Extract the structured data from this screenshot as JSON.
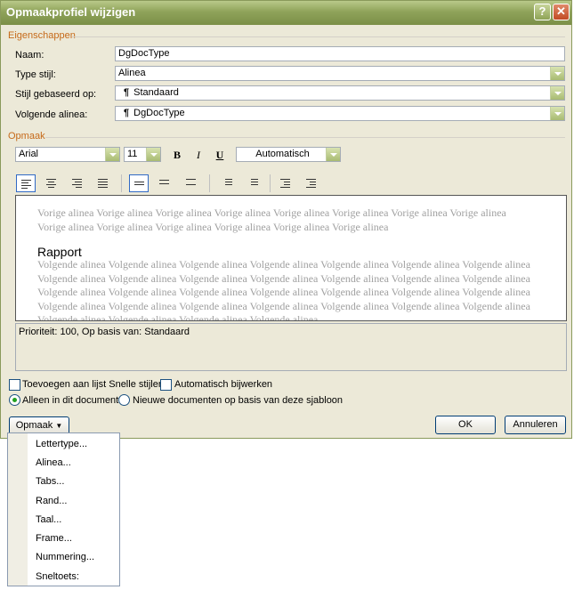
{
  "window": {
    "title": "Opmaakprofiel wijzigen",
    "help_glyph": "?",
    "close_glyph": "✕"
  },
  "sections": {
    "properties": "Eigenschappen",
    "format": "Opmaak"
  },
  "properties": {
    "name_label": "Naam:",
    "name_value": "DgDocType",
    "type_label": "Type stijl:",
    "type_value": "Alinea",
    "based_label": "Stijl gebaseerd op:",
    "based_value": "Standaard",
    "next_label": "Volgende alinea:",
    "next_value": "DgDocType",
    "pilcrow": "¶"
  },
  "format_toolbar": {
    "font": "Arial",
    "size": "11",
    "bold": "B",
    "italic": "I",
    "underline": "U",
    "color": "Automatisch"
  },
  "preview": {
    "previous": "Vorige alinea Vorige alinea Vorige alinea Vorige alinea Vorige alinea Vorige alinea Vorige alinea Vorige alinea Vorige alinea Vorige alinea Vorige alinea Vorige alinea Vorige alinea Vorige alinea",
    "sample": "Rapport",
    "following": "Volgende alinea Volgende alinea Volgende alinea Volgende alinea Volgende alinea Volgende alinea Volgende alinea Volgende alinea Volgende alinea Volgende alinea Volgende alinea Volgende alinea Volgende alinea Volgende alinea Volgende alinea Volgende alinea Volgende alinea Volgende alinea Volgende alinea Volgende alinea Volgende alinea Volgende alinea Volgende alinea Volgende alinea Volgende alinea Volgende alinea Volgende alinea Volgende alinea Volgende alinea Volgende alinea Volgende alinea Volgende alinea"
  },
  "description": "Prioriteit: 100, Op basis van: Standaard",
  "options": {
    "add_quick": "Toevoegen aan lijst Snelle stijlen",
    "auto_update": "Automatisch bijwerken",
    "only_doc": "Alleen in dit document",
    "new_docs": "Nieuwe documenten op basis van deze sjabloon"
  },
  "buttons": {
    "format": "Opmaak",
    "ok": "OK",
    "cancel": "Annuleren"
  },
  "format_menu": [
    "Lettertype...",
    "Alinea...",
    "Tabs...",
    "Rand...",
    "Taal...",
    "Frame...",
    "Nummering...",
    "Sneltoets:"
  ]
}
